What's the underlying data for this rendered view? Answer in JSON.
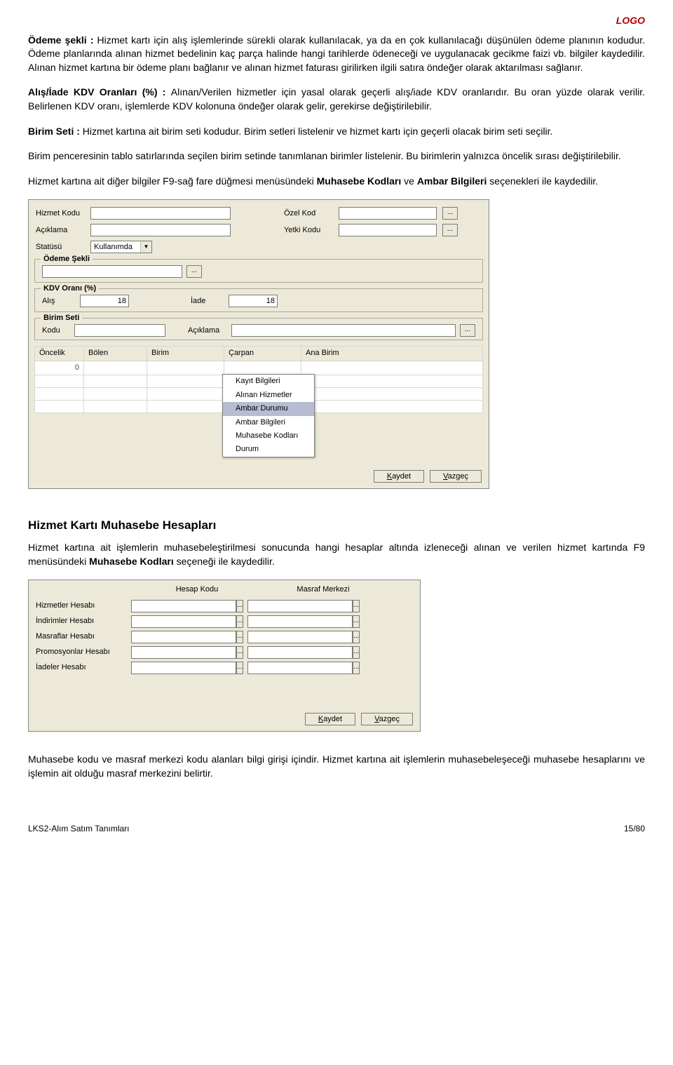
{
  "logo": "LOGO",
  "p1": {
    "lead": "Ödeme şekli : ",
    "text": "Hizmet kartı için alış işlemlerinde sürekli olarak kullanılacak, ya da en çok kullanılacağı düşünülen ödeme planının kodudur. Ödeme planlarında alınan hizmet bedelinin kaç parça halinde hangi tarihlerde ödeneceği ve uygulanacak gecikme faizi vb. bilgiler kaydedilir. Alınan hizmet kartına bir ödeme planı bağlanır ve alınan hizmet faturası girilirken ilgili satıra öndeğer olarak aktarılması sağlanır."
  },
  "p2": {
    "lead": "Alış/İade KDV Oranları (%) : ",
    "text": "Alınan/Verilen hizmetler için yasal olarak geçerli alış/iade KDV oranlarıdır. Bu oran yüzde olarak verilir. Belirlenen KDV oranı, işlemlerde KDV kolonuna öndeğer olarak gelir, gerekirse değiştirilebilir."
  },
  "p3": {
    "lead": "Birim Seti : ",
    "text": "Hizmet kartına ait birim seti kodudur. Birim setleri listelenir ve hizmet kartı için geçerli olacak birim seti seçilir."
  },
  "p4": "Birim penceresinin tablo satırlarında seçilen birim setinde tanımlanan birimler listelenir. Bu birimlerin yalnızca öncelik sırası değiştirilebilir.",
  "p5a": "Hizmet kartına ait diğer bilgiler F9-sağ fare düğmesi menüsündeki ",
  "p5b": "Muhasebe Kodları",
  "p5c": " ve ",
  "p5d": "Ambar Bilgileri",
  "p5e": " seçenekleri ile kaydedilir.",
  "dialog": {
    "labels": {
      "hizmetKodu": "Hizmet Kodu",
      "ozelKod": "Özel Kod",
      "aciklama": "Açıklama",
      "yetkiKodu": "Yetki Kodu",
      "statusu": "Statüsü",
      "statusuVal": "Kullanımda",
      "odemeSekli": "Ödeme Şekli",
      "kdvOrani": "KDV Oranı (%)",
      "alis": "Alış",
      "alisVal": "18",
      "iade": "İade",
      "iadeVal": "18",
      "birimSeti": "Birim Seti",
      "kodu": "Kodu",
      "aciklama2": "Açıklama"
    },
    "tableHeaders": [
      "Öncelik",
      "Bölen",
      "Birim",
      "Çarpan",
      "Ana Birim"
    ],
    "tableRow": {
      "oncelik": "0"
    },
    "ctxMenu": [
      "Kayıt Bilgileri",
      "Alınan Hizmetler",
      "Ambar Durumu",
      "Ambar Bilgileri",
      "Muhasebe Kodları",
      "Durum"
    ],
    "ctxSelectedIndex": 2,
    "buttons": {
      "kaydet": "Kaydet",
      "vazgec": "Vazgeç",
      "kaydetU": "K",
      "vazgecU": "V"
    }
  },
  "section2": {
    "title": "Hizmet Kartı Muhasebe Hesapları",
    "p1a": "Hizmet kartına ait işlemlerin muhasebeleştirilmesi sonucunda hangi hesaplar altında izleneceği alınan ve verilen hizmet kartında F9 menüsündeki ",
    "p1b": "Muhasebe Kodları",
    "p1c": " seçeneği ile kaydedilir."
  },
  "accDialog": {
    "headers": {
      "hesapKodu": "Hesap Kodu",
      "masrafMerkezi": "Masraf Merkezi"
    },
    "rows": [
      "Hizmetler Hesabı",
      "İndirimler Hesabı",
      "Masraflar Hesabı",
      "Promosyonlar Hesabı",
      "İadeler Hesabı"
    ]
  },
  "p6": "Muhasebe kodu ve masraf merkezi kodu alanları bilgi girişi içindir. Hizmet kartına ait işlemlerin muhasebeleşeceği muhasebe hesaplarını ve işlemin ait olduğu masraf merkezini belirtir.",
  "footer": {
    "left": "LKS2-Alım Satım Tanımları",
    "right": "15/80"
  }
}
